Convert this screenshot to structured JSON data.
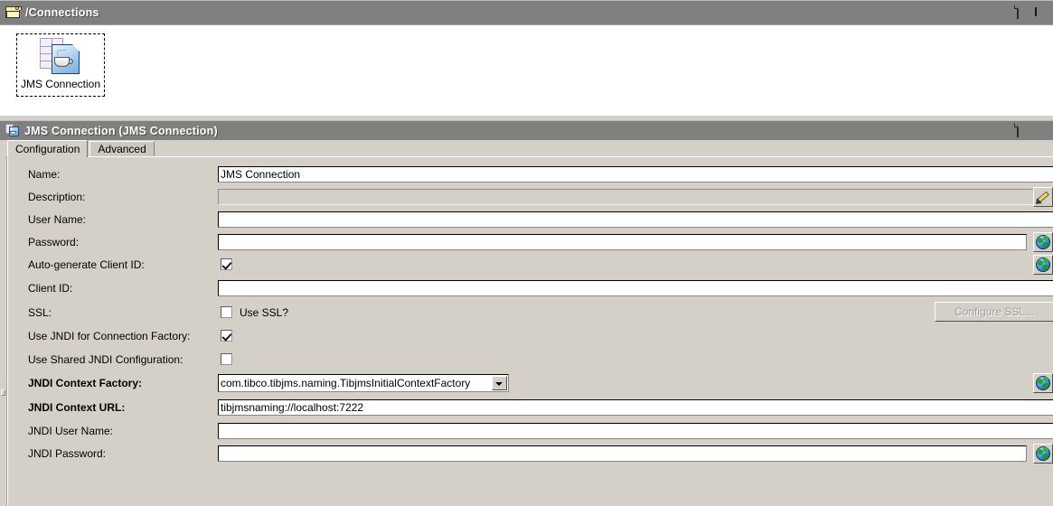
{
  "canvas_panel": {
    "title": "/Connections",
    "folder_icon": "folder-icon",
    "buttons": [
      {
        "name": "page-icon",
        "label": ""
      },
      {
        "name": "maximize-icon",
        "label": ""
      }
    ],
    "nodes": [
      {
        "label": "JMS Connection",
        "icon": "jms-connection-icon"
      }
    ]
  },
  "props_panel": {
    "title": "JMS Connection (JMS Connection)",
    "icon": "jms-connection-small-icon",
    "buttons": [
      {
        "name": "page-icon",
        "label": ""
      },
      {
        "name": "minimize-icon",
        "label": ""
      }
    ],
    "tabs": [
      {
        "label": "Configuration",
        "active": true
      },
      {
        "label": "Advanced",
        "active": false
      }
    ],
    "fields": [
      {
        "label": "Name:",
        "type": "text",
        "value": "JMS Connection",
        "bold": false,
        "readonly": false,
        "accessory": "none"
      },
      {
        "label": "Description:",
        "type": "text",
        "value": "",
        "bold": false,
        "readonly": true,
        "accessory": "pencil"
      },
      {
        "label": "User Name:",
        "type": "text",
        "value": "",
        "bold": false,
        "readonly": false,
        "accessory": "none"
      },
      {
        "label": "Password:",
        "type": "text",
        "value": "",
        "bold": false,
        "readonly": false,
        "accessory": "globe"
      },
      {
        "label": "Auto-generate Client ID:",
        "type": "checkbox",
        "checked": true,
        "bold": false,
        "cb_label": "",
        "accessory": "globe"
      },
      {
        "label": "Client ID:",
        "type": "text",
        "value": "",
        "bold": false,
        "readonly": false,
        "accessory": "none"
      },
      {
        "label": "SSL:",
        "type": "checkbox",
        "checked": false,
        "bold": false,
        "cb_label": "Use SSL?",
        "accessory": "button",
        "button_label": "Configure SSL...",
        "button_disabled": true
      },
      {
        "label": "Use JNDI for Connection Factory:",
        "type": "checkbox",
        "checked": true,
        "bold": false,
        "cb_label": "",
        "accessory": "none"
      },
      {
        "label": "Use Shared JNDI Configuration:",
        "type": "checkbox",
        "checked": false,
        "bold": false,
        "cb_label": "",
        "accessory": "none"
      },
      {
        "label": "JNDI Context Factory:",
        "type": "combo",
        "value": "com.tibco.tibjms.naming.TibjmsInitialContextFactory",
        "bold": true,
        "accessory": "globe"
      },
      {
        "label": "JNDI Context URL:",
        "type": "text",
        "value": "tibjmsnaming://localhost:7222",
        "bold": true,
        "readonly": false,
        "accessory": "none"
      },
      {
        "label": "JNDI User Name:",
        "type": "text",
        "value": "",
        "bold": false,
        "readonly": false,
        "accessory": "none"
      },
      {
        "label": "JNDI Password:",
        "type": "text",
        "value": "",
        "bold": false,
        "readonly": false,
        "accessory": "globe"
      }
    ]
  },
  "colors": {
    "titlebar": "#808080",
    "face": "#d4d0c8",
    "canvas": "#ffffff",
    "field_border": "#000000"
  }
}
